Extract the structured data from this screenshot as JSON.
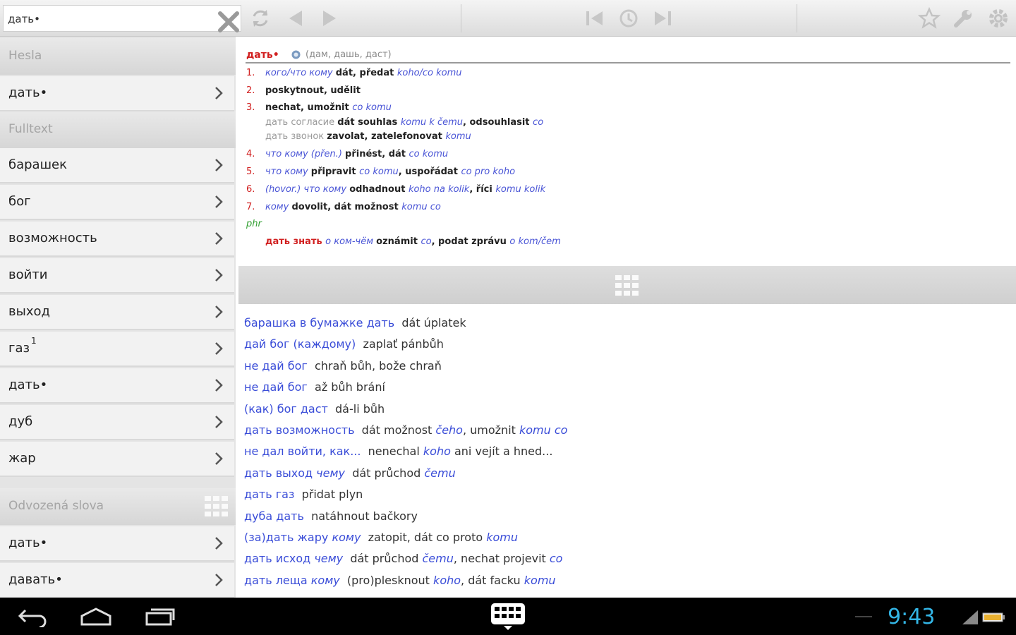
{
  "search": {
    "value": "дать•"
  },
  "left": {
    "headwords_title": "Hesla",
    "headwords": [
      {
        "label": "дать•"
      }
    ],
    "fulltext_title": "Fulltext",
    "fulltext": [
      {
        "label": "барашек"
      },
      {
        "label": "бог"
      },
      {
        "label": "возможность"
      },
      {
        "label": "войти"
      },
      {
        "label": "выход"
      },
      {
        "label": "газ",
        "sup": "1"
      },
      {
        "label": "дать•"
      },
      {
        "label": "дуб"
      },
      {
        "label": "жар"
      }
    ],
    "derived_title": "Odvozená slova",
    "derived": [
      {
        "label": "дать•"
      },
      {
        "label": "давать•"
      }
    ]
  },
  "entry": {
    "headword": "дать•",
    "forms": "(дам, дашь, даст)",
    "senses": [
      {
        "num": "1.",
        "parts": [
          {
            "t": "кого/что кому ",
            "c": "ru"
          },
          {
            "t": "dát, předat ",
            "c": "cz"
          },
          {
            "t": "koho/co komu",
            "c": "czi"
          }
        ]
      },
      {
        "num": "2.",
        "parts": [
          {
            "t": "poskytnout, udělit",
            "c": "cz"
          }
        ]
      },
      {
        "num": "3.",
        "parts": [
          {
            "t": "nechat, umožnit ",
            "c": "cz"
          },
          {
            "t": "co komu",
            "c": "czi"
          }
        ]
      },
      {
        "num": "",
        "parts": [
          {
            "t": "дать согласие ",
            "c": "ru-gray"
          },
          {
            "t": "dát souhlas ",
            "c": "cz"
          },
          {
            "t": "komu k čemu",
            "c": "czi"
          },
          {
            "t": ", odsouhlasit ",
            "c": "cz"
          },
          {
            "t": "co",
            "c": "czi"
          }
        ]
      },
      {
        "num": "",
        "parts": [
          {
            "t": "дать звонок ",
            "c": "ru-gray"
          },
          {
            "t": "zavolat, zatelefonovat ",
            "c": "cz"
          },
          {
            "t": "komu",
            "c": "czi"
          }
        ]
      },
      {
        "num": "4.",
        "parts": [
          {
            "t": "что кому (přen.) ",
            "c": "ru"
          },
          {
            "t": "přinést, dát ",
            "c": "cz"
          },
          {
            "t": "co komu",
            "c": "czi"
          }
        ]
      },
      {
        "num": "5.",
        "parts": [
          {
            "t": "что кому ",
            "c": "ru"
          },
          {
            "t": "připravit ",
            "c": "cz"
          },
          {
            "t": "co komu",
            "c": "czi"
          },
          {
            "t": ", uspořádat ",
            "c": "cz"
          },
          {
            "t": "co pro koho",
            "c": "czi"
          }
        ]
      },
      {
        "num": "6.",
        "parts": [
          {
            "t": "(hovor.) что кому ",
            "c": "ru"
          },
          {
            "t": "odhadnout ",
            "c": "cz"
          },
          {
            "t": "koho na kolik",
            "c": "czi"
          },
          {
            "t": ", říci ",
            "c": "cz"
          },
          {
            "t": "komu kolik",
            "c": "czi"
          }
        ]
      },
      {
        "num": "7.",
        "parts": [
          {
            "t": "кому ",
            "c": "ru"
          },
          {
            "t": "dovolit, dát možnost ",
            "c": "cz"
          },
          {
            "t": "komu co",
            "c": "czi"
          }
        ]
      }
    ],
    "phr_label": "phr",
    "phrase": [
      {
        "t": "дать знать ",
        "c": "ru-red"
      },
      {
        "t": "о ком-чём ",
        "c": "ru"
      },
      {
        "t": "oznámit ",
        "c": "cz"
      },
      {
        "t": "co",
        "c": "czi"
      },
      {
        "t": ", podat zprávu ",
        "c": "cz"
      },
      {
        "t": "o kom/čem",
        "c": "czi"
      }
    ]
  },
  "results": [
    [
      {
        "t": "барашка в бумажке дать",
        "c": "a"
      },
      {
        "t": "  dát úplatek",
        "c": "b"
      }
    ],
    [
      {
        "t": "дай бог (каждому)",
        "c": "a"
      },
      {
        "t": "  zaplať pánbůh",
        "c": "b"
      }
    ],
    [
      {
        "t": "не дай бог",
        "c": "a"
      },
      {
        "t": "  chraň bůh, bože chraň",
        "c": "b"
      }
    ],
    [
      {
        "t": "не дай бог",
        "c": "a"
      },
      {
        "t": "  až bůh brání",
        "c": "b"
      }
    ],
    [
      {
        "t": "(как) бог даст",
        "c": "a"
      },
      {
        "t": "  dá-li bůh",
        "c": "b"
      }
    ],
    [
      {
        "t": "дать возможность",
        "c": "a"
      },
      {
        "t": "  dát možnost ",
        "c": "b"
      },
      {
        "t": "čeho",
        "c": "ai"
      },
      {
        "t": ", umožnit ",
        "c": "b"
      },
      {
        "t": "komu co",
        "c": "ai"
      }
    ],
    [
      {
        "t": "не дал войти, как...",
        "c": "a"
      },
      {
        "t": "  nenechal ",
        "c": "b"
      },
      {
        "t": "koho",
        "c": "ai"
      },
      {
        "t": " ani vejít a hned...",
        "c": "b"
      }
    ],
    [
      {
        "t": "дать выход ",
        "c": "a"
      },
      {
        "t": "чему",
        "c": "ai"
      },
      {
        "t": "  dát průchod ",
        "c": "b"
      },
      {
        "t": "čemu",
        "c": "ai"
      }
    ],
    [
      {
        "t": "дать газ",
        "c": "a"
      },
      {
        "t": "  přidat plyn",
        "c": "b"
      }
    ],
    [
      {
        "t": "дуба дать",
        "c": "a"
      },
      {
        "t": "  natáhnout bačkory",
        "c": "b"
      }
    ],
    [
      {
        "t": "(за)дать жару ",
        "c": "a"
      },
      {
        "t": "кому",
        "c": "ai"
      },
      {
        "t": "  zatopit, dát co proto ",
        "c": "b"
      },
      {
        "t": "komu",
        "c": "ai"
      }
    ],
    [
      {
        "t": "дать исход ",
        "c": "a"
      },
      {
        "t": "чему",
        "c": "ai"
      },
      {
        "t": "  dát průchod ",
        "c": "b"
      },
      {
        "t": "čemu",
        "c": "ai"
      },
      {
        "t": ", nechat projevit ",
        "c": "b"
      },
      {
        "t": "co",
        "c": "ai"
      }
    ],
    [
      {
        "t": "дать леща ",
        "c": "a"
      },
      {
        "t": "кому",
        "c": "ai"
      },
      {
        "t": "  (pro)plesknout ",
        "c": "b"
      },
      {
        "t": "koho",
        "c": "ai"
      },
      {
        "t": ", dát facku ",
        "c": "b"
      },
      {
        "t": "komu",
        "c": "ai"
      }
    ]
  ],
  "status": {
    "time": "9:43"
  },
  "icons": {
    "clear": "close-icon",
    "swap": "swap-direction-icon",
    "back": "arrow-left-icon",
    "forward": "arrow-right-icon",
    "hist_back": "history-back-icon",
    "history": "history-icon",
    "hist_fwd": "history-forward-icon",
    "favorite": "star-icon",
    "tools": "wrench-icon",
    "settings": "gear-icon",
    "grid": "grid-handle-icon",
    "chevron": "chevron-right-icon"
  },
  "colors": {
    "accent_blue": "#3a4dd8",
    "headword_red": "#d12020",
    "phrase_green": "#33a033",
    "clock": "#33b5e5"
  }
}
